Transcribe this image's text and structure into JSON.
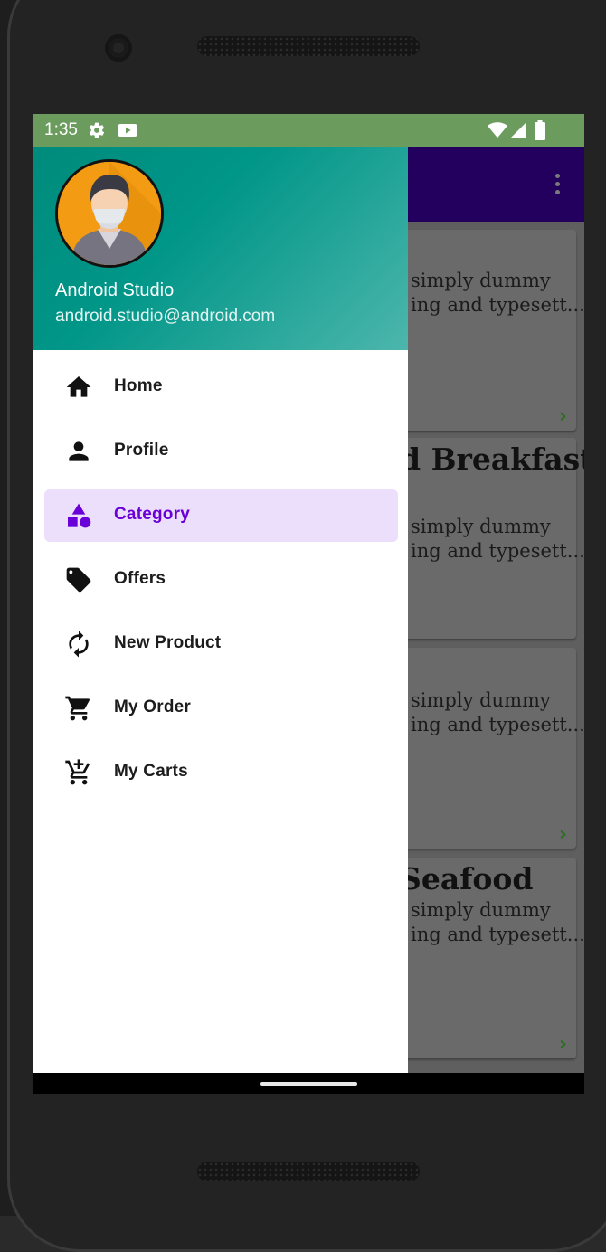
{
  "status_bar": {
    "time": "1:35",
    "icons": [
      "gear-icon",
      "play-icon",
      "wifi-icon",
      "signal-icon",
      "battery-icon"
    ]
  },
  "drawer": {
    "user_name": "Android Studio",
    "user_email": "android.studio@android.com",
    "avatar_icon": "user-avatar",
    "header_gradient": [
      "#008b7c",
      "#4db6ac"
    ],
    "items": [
      {
        "label": "Home",
        "icon": "home-icon",
        "active": false
      },
      {
        "label": "Profile",
        "icon": "person-icon",
        "active": false
      },
      {
        "label": "Category",
        "icon": "category-icon",
        "active": true
      },
      {
        "label": "Offers",
        "icon": "tag-icon",
        "active": false
      },
      {
        "label": "New Product",
        "icon": "refresh-icon",
        "active": false
      },
      {
        "label": "My Order",
        "icon": "cart-icon",
        "active": false
      },
      {
        "label": "My Carts",
        "icon": "add-cart-icon",
        "active": false
      }
    ],
    "active_color": "#6a00d8",
    "active_bg": "#ebdffb"
  },
  "background_app": {
    "toolbar_color": "#24005e",
    "cards": [
      {
        "title": "",
        "line1": "simply dummy",
        "line2": "ing and typesett..."
      },
      {
        "title": "d Breakfast",
        "line1": "simply dummy",
        "line2": "ing and typesett..."
      },
      {
        "title": "",
        "line1": "simply dummy",
        "line2": "ing and typesett..."
      },
      {
        "title": "Seafood",
        "line1": "simply dummy",
        "line2": "ing and typesett..."
      }
    ]
  }
}
